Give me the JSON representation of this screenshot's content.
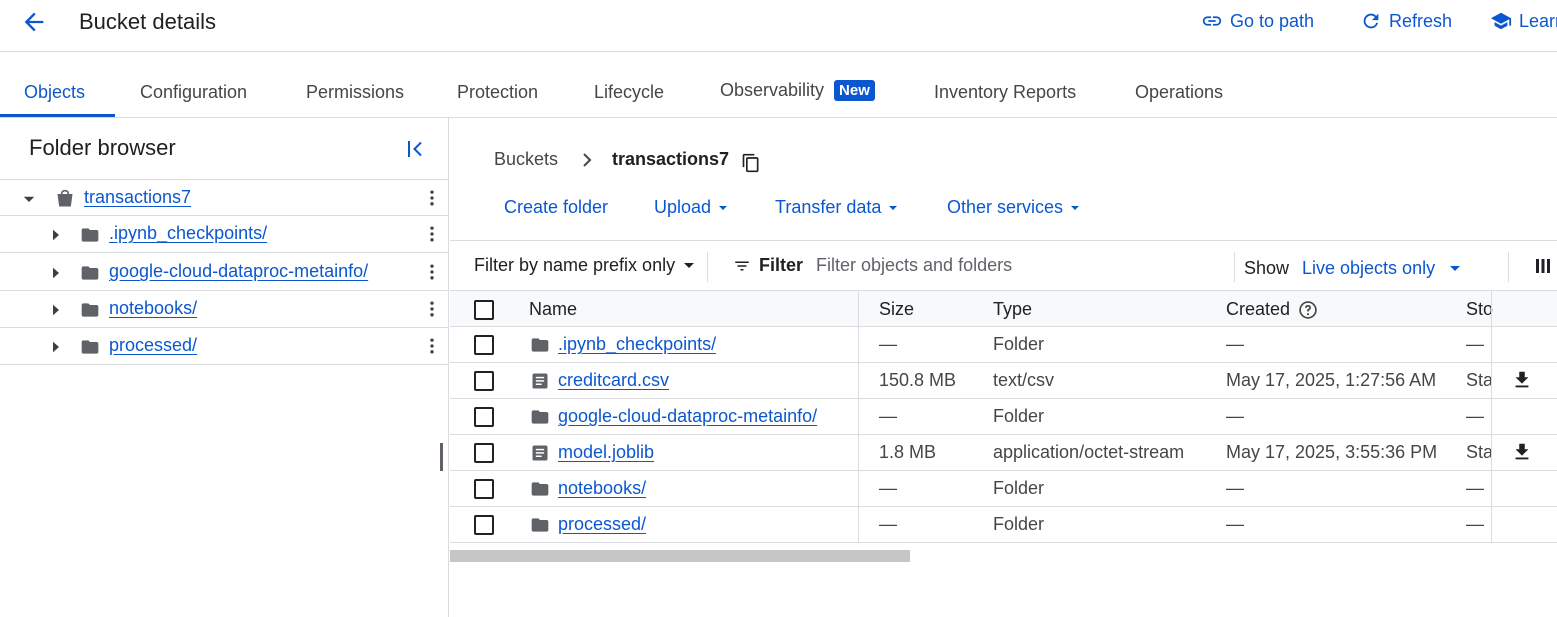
{
  "header": {
    "title": "Bucket details",
    "go_to_path": "Go to path",
    "refresh": "Refresh",
    "learn": "Learn"
  },
  "tabs": [
    {
      "label": "Objects",
      "active": true
    },
    {
      "label": "Configuration"
    },
    {
      "label": "Permissions"
    },
    {
      "label": "Protection"
    },
    {
      "label": "Lifecycle"
    },
    {
      "label": "Observability",
      "badge": "New"
    },
    {
      "label": "Inventory Reports"
    },
    {
      "label": "Operations"
    }
  ],
  "folder_browser": {
    "title": "Folder browser",
    "items": [
      {
        "label": "transactions7",
        "type": "bucket",
        "expanded": true
      },
      {
        "label": ".ipynb_checkpoints/",
        "type": "folder"
      },
      {
        "label": "google-cloud-dataproc-metainfo/",
        "type": "folder"
      },
      {
        "label": "notebooks/",
        "type": "folder"
      },
      {
        "label": "processed/",
        "type": "folder"
      }
    ]
  },
  "breadcrumb": {
    "root": "Buckets",
    "current": "transactions7"
  },
  "toolbar": {
    "create_folder": "Create folder",
    "upload": "Upload",
    "transfer_data": "Transfer data",
    "other_services": "Other services"
  },
  "filterbar": {
    "prefix_mode": "Filter by name prefix only",
    "filter_label": "Filter",
    "filter_placeholder": "Filter objects and folders",
    "show_label": "Show",
    "show_value": "Live objects only"
  },
  "table": {
    "headers": {
      "name": "Name",
      "size": "Size",
      "type": "Type",
      "created": "Created",
      "storage": "Sto"
    },
    "rows": [
      {
        "name": ".ipynb_checkpoints/",
        "kind": "folder",
        "size": "—",
        "type": "Folder",
        "created": "—",
        "storage": "—"
      },
      {
        "name": "creditcard.csv",
        "kind": "file",
        "size": "150.8 MB",
        "type": "text/csv",
        "created": "May 17, 2025, 1:27:56 AM",
        "storage": "Sta"
      },
      {
        "name": "google-cloud-dataproc-metainfo/",
        "kind": "folder",
        "size": "—",
        "type": "Folder",
        "created": "—",
        "storage": "—"
      },
      {
        "name": "model.joblib",
        "kind": "file",
        "size": "1.8 MB",
        "type": "application/octet-stream",
        "created": "May 17, 2025, 3:55:36 PM",
        "storage": "Sta"
      },
      {
        "name": "notebooks/",
        "kind": "folder",
        "size": "—",
        "type": "Folder",
        "created": "—",
        "storage": "—"
      },
      {
        "name": "processed/",
        "kind": "folder",
        "size": "—",
        "type": "Folder",
        "created": "—",
        "storage": "—"
      }
    ]
  },
  "colors": {
    "accent": "#0b57d0",
    "border": "#dadce0",
    "text": "#202124",
    "muted": "#444746",
    "icon": "#5f6368"
  }
}
